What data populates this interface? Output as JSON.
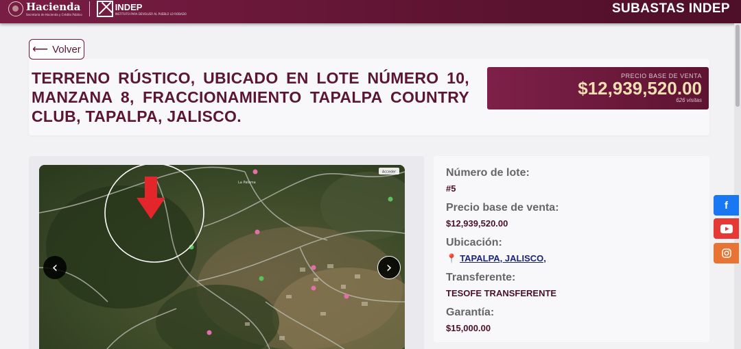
{
  "header": {
    "hacienda_name": "Hacienda",
    "hacienda_subtitle": "Secretaría de Hacienda y Crédito Público",
    "indep_name": "INDEP",
    "indep_subtitle": "INSTITUTO PARA DEVOLVER AL PUEBLO LO ROBADO",
    "site_title": "SUBASTAS INDEP",
    "bar_color": "#6b1a3d"
  },
  "back_button": {
    "label": "Volver",
    "icon": "arrow-left-icon"
  },
  "property": {
    "title": "TERRENO RÚSTICO, UBICADO EN LOTE NÚMERO 10, MANZANA 8, FRACCIONAMIENTO TAPALPA COUNTRY CLUB, TAPALPA, JALISCO.",
    "price_label": "PRECIO BASE DE VENTA",
    "price": "$12,939,520.00",
    "visits": "626 visitas",
    "accent_color": "#f3dfb4"
  },
  "gallery": {
    "map_badge": "Acceder",
    "prev_icon": "chevron-left-icon",
    "next_icon": "chevron-right-icon",
    "map_labels": [
      "La Paloma"
    ]
  },
  "details": [
    {
      "label": "Número de lote:",
      "value": "#5"
    },
    {
      "label": "Precio base de venta:",
      "value": "$12,939,520.00"
    },
    {
      "label": "Ubicación:",
      "value": "TAPALPA, JALISCO,",
      "link": true,
      "icon": "map-pin-icon"
    },
    {
      "label": "Transferente:",
      "value": "TESOFE TRANSFERENTE"
    },
    {
      "label": "Garantía:",
      "value": "$15,000.00"
    }
  ],
  "social": [
    {
      "name": "facebook",
      "glyph": "f",
      "color": "#1877f2"
    },
    {
      "name": "youtube",
      "color": "#e53935"
    },
    {
      "name": "instagram",
      "color": "#e87434"
    }
  ]
}
